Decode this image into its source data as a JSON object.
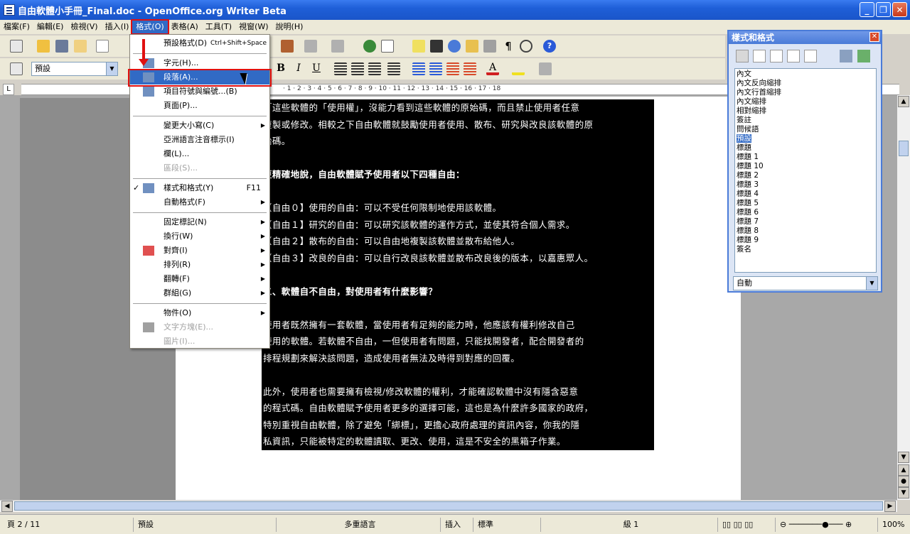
{
  "window": {
    "title": "自由軟體小手冊_Final.doc - OpenOffice.org Writer Beta",
    "btn_min": "_",
    "btn_max": "❐",
    "btn_close": "✕"
  },
  "menubar": [
    {
      "label": "檔案(F)"
    },
    {
      "label": "編輯(E)"
    },
    {
      "label": "檢視(V)"
    },
    {
      "label": "插入(I)"
    },
    {
      "label": "格式(O)",
      "active": true
    },
    {
      "label": "表格(A)"
    },
    {
      "label": "工具(T)"
    },
    {
      "label": "視窗(W)"
    },
    {
      "label": "說明(H)"
    }
  ],
  "toolbar": {
    "para_style": "預設",
    "font_name": "",
    "bold": "B",
    "italic": "I",
    "underline": "U"
  },
  "ruler": {
    "corner": "L",
    "ticks": "· 1 · 2 · 3 · 4 · 5 · 6 · 7 · 8 · 9 · 10 · 11 · 12 · 13 · 14 · 15 · 16 · 17 · 18"
  },
  "format_menu": {
    "items": [
      {
        "label": "預設格式(D)",
        "shortcut": "Ctrl+Shift+Space"
      },
      {
        "label": "字元(H)..."
      },
      {
        "label": "段落(A)...",
        "highlighted": true
      },
      {
        "label": "項目符號與編號...(B)"
      },
      {
        "label": "頁面(P)..."
      },
      {
        "label": "變更大小寫(C)",
        "submenu": true
      },
      {
        "label": "亞洲語言注音標示(I)"
      },
      {
        "label": "欄(L)..."
      },
      {
        "label": "區段(S)...",
        "disabled": true
      },
      {
        "label": "樣式和格式(Y)",
        "shortcut": "F11",
        "checked": true
      },
      {
        "label": "自動格式(F)",
        "submenu": true
      },
      {
        "label": "固定標記(N)",
        "submenu": true
      },
      {
        "label": "換行(W)",
        "submenu": true
      },
      {
        "label": "對齊(I)",
        "submenu": true
      },
      {
        "label": "排列(R)",
        "submenu": true
      },
      {
        "label": "翻轉(F)",
        "submenu": true
      },
      {
        "label": "群組(G)",
        "submenu": true
      },
      {
        "label": "物件(O)",
        "submenu": true
      },
      {
        "label": "文字方塊(E)...",
        "disabled": true
      },
      {
        "label": "圖片(I)...",
        "disabled": true
      }
    ],
    "check_mark": "✓",
    "submenu_arrow": "▶"
  },
  "document": {
    "lines": [
      "「這些軟體的「使用權」，沒能力看到這些軟體的原始碼，而且禁止使用者任意",
      "複製或修改。相較之下自由軟體就鼓勵使用者使用、散布、研究與改良該軟體的原",
      "始碼。",
      "",
      "更精確地說，自由軟體賦予使用者以下四種自由：",
      "",
      "【自由０】使用的自由：可以不受任何限制地使用該軟體。",
      "【自由１】研究的自由：可以研究該軟體的運作方式，並使其符合個人需求。",
      "【自由２】散布的自由：可以自由地複製該軟體並散布給他人。",
      "【自由３】改良的自由：可以自行改良該軟體並散布改良後的版本，以嘉惠眾人。",
      "",
      "二、軟體自不自由，對使用者有什麼影響？",
      "",
      "使用者既然擁有一套軟體，當使用者有足夠的能力時，他應該有權利修改自己",
      "使用的軟體。若軟體不自由，一但使用者有問題，只能找開發者，配合開發者的",
      "排程規劃來解決該問題，造成使用者無法及時得到對應的回覆。",
      "",
      "此外，使用者也需要擁有檢視/修改軟體的權利，才能確認軟體中沒有隱含惡意",
      "的程式碼。自由軟體賦予使用者更多的選擇可能，這也是為什麼許多國家的政府，",
      "特別重視自由軟體，除了避免「綁標」，更擔心政府處理的資訊內容，你我的隱",
      "私資訊，只能被特定的軟體讀取、更改、使用，這是不安全的黑箱子作業。"
    ]
  },
  "styles_panel": {
    "title": "樣式和格式",
    "styles": [
      "內文",
      "內文反向縮排",
      "內文行首縮排",
      "內文縮排",
      "相對縮排",
      "簽註",
      "問候語",
      "預設",
      "標題",
      "標題 1",
      "標題 10",
      "標題 2",
      "標題 3",
      "標題 4",
      "標題 5",
      "標題 6",
      "標題 7",
      "標題 8",
      "標題 9",
      "簽名"
    ],
    "selected": "預設",
    "filter": "自動"
  },
  "statusbar": {
    "page": "頁 2 / 11",
    "style": "預設",
    "language": "多重語言",
    "insert_mode": "插入",
    "selection_mode": "標準",
    "level": "級 1",
    "zoom": "100%"
  },
  "colors": {
    "titlebar": "#1f5fd8",
    "highlight": "#316ac5",
    "annotation": "#e01010"
  }
}
